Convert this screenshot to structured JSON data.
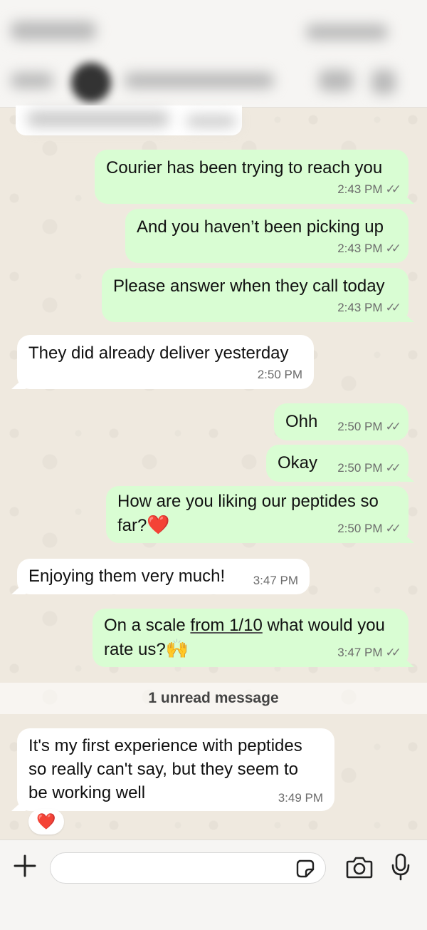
{
  "chat": {
    "messages": [
      {
        "id": "m1",
        "dir": "out",
        "text": "Courier has been trying to reach you",
        "time": "2:43 PM",
        "ticks": "✓✓"
      },
      {
        "id": "m2",
        "dir": "out",
        "text": "And you haven’t been picking up",
        "time": "2:43 PM",
        "ticks": "✓✓"
      },
      {
        "id": "m3",
        "dir": "out",
        "text": "Please answer when they call today",
        "time": "2:43 PM",
        "ticks": "✓✓"
      },
      {
        "id": "m4",
        "dir": "in",
        "text": "They did already deliver yesterday",
        "time": "2:50 PM"
      },
      {
        "id": "m5",
        "dir": "out",
        "text": "Ohh",
        "time": "2:50 PM",
        "ticks": "✓✓"
      },
      {
        "id": "m6",
        "dir": "out",
        "text": "Okay",
        "time": "2:50 PM",
        "ticks": "✓✓"
      },
      {
        "id": "m7",
        "dir": "out",
        "text_line1": "How are you liking our peptides so",
        "text_line2": "far?",
        "emoji": "❤️",
        "time": "2:50 PM",
        "ticks": "✓✓"
      },
      {
        "id": "m8",
        "dir": "in",
        "text": "Enjoying them very much!",
        "time": "3:47 PM"
      },
      {
        "id": "m9",
        "dir": "out",
        "text_pre": "On a scale ",
        "text_link": "from 1/10",
        "text_post": " what would you",
        "text_line2": "rate us?",
        "emoji": "🙌",
        "time": "3:47 PM",
        "ticks": "✓✓"
      },
      {
        "id": "m10",
        "dir": "in",
        "text_line1": "It's my first experience with peptides",
        "text_line2": "so really can't say, but they seem to",
        "text_line3": "be working well",
        "time": "3:49 PM"
      }
    ],
    "unread_label": "1 unread message",
    "reaction": "❤️"
  },
  "composer": {
    "placeholder": ""
  },
  "icons": [
    "plus-icon",
    "sticker-icon",
    "camera-icon",
    "microphone-icon"
  ]
}
